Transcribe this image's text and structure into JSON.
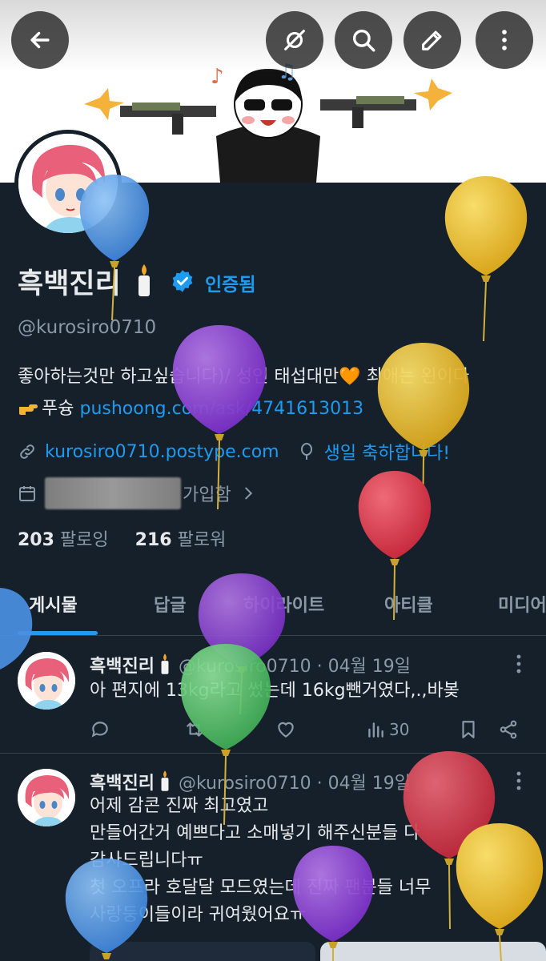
{
  "toolbar": {
    "back_icon": "arrow-left-icon",
    "icons": [
      "no-location-icon",
      "search-icon",
      "edit-icon",
      "more-vertical-icon"
    ]
  },
  "profile": {
    "display_name": "흑백진리",
    "candle_emoji": "🕯",
    "verified_label": "인증됨",
    "handle": "@kurosiro0710",
    "bio_line1": "좋아하는것만 하고싶습니다)/ 성인 태섭대만🧡 최애는 왼이다",
    "bio_line2_prefix": "푸슝 ",
    "bio_line2_link": "pushoong.com/ask/4741613013",
    "website": "kurosiro0710.postype.com",
    "birthday": "생일 축하합니다!",
    "joined_suffix": "가입함",
    "following_count": "203",
    "following_label": "팔로잉",
    "followers_count": "216",
    "followers_label": "팔로워"
  },
  "tabs": [
    {
      "label": "게시물",
      "active": true
    },
    {
      "label": "답글",
      "active": false
    },
    {
      "label": "하이라이트",
      "active": false
    },
    {
      "label": "아티클",
      "active": false
    },
    {
      "label": "미디어",
      "active": false
    }
  ],
  "posts": [
    {
      "name": "흑백진리",
      "handle": "@kurosiro0710",
      "date": "· 04월 19일",
      "lines": [
        "아 편지에 13kg라고 썼는데 16kg뺀거였다,.,바봊"
      ],
      "views": "30"
    },
    {
      "name": "흑백진리",
      "handle": "@kurosiro0710",
      "date": "· 04월 19일",
      "lines": [
        "어제 감콘 진짜 최고였고",
        "만들어간거 예쁘다고 소매넣기 해주신분들 다",
        "감사드립니다ㅠ",
        "첫 오프라 호달달 모드였는데 진짜 팬분들 너무",
        "사랑둥이들이라 귀여웠어요ㅠ"
      ]
    }
  ],
  "colors": {
    "background": "#15202b",
    "accent": "#1d9bf0",
    "muted": "#8b98a5",
    "balloon_blue": "#4a90e2",
    "balloon_purple": "#8e3fd6",
    "balloon_yellow": "#e8b92e",
    "balloon_red": "#d63a4a",
    "balloon_green": "#55c36a"
  }
}
